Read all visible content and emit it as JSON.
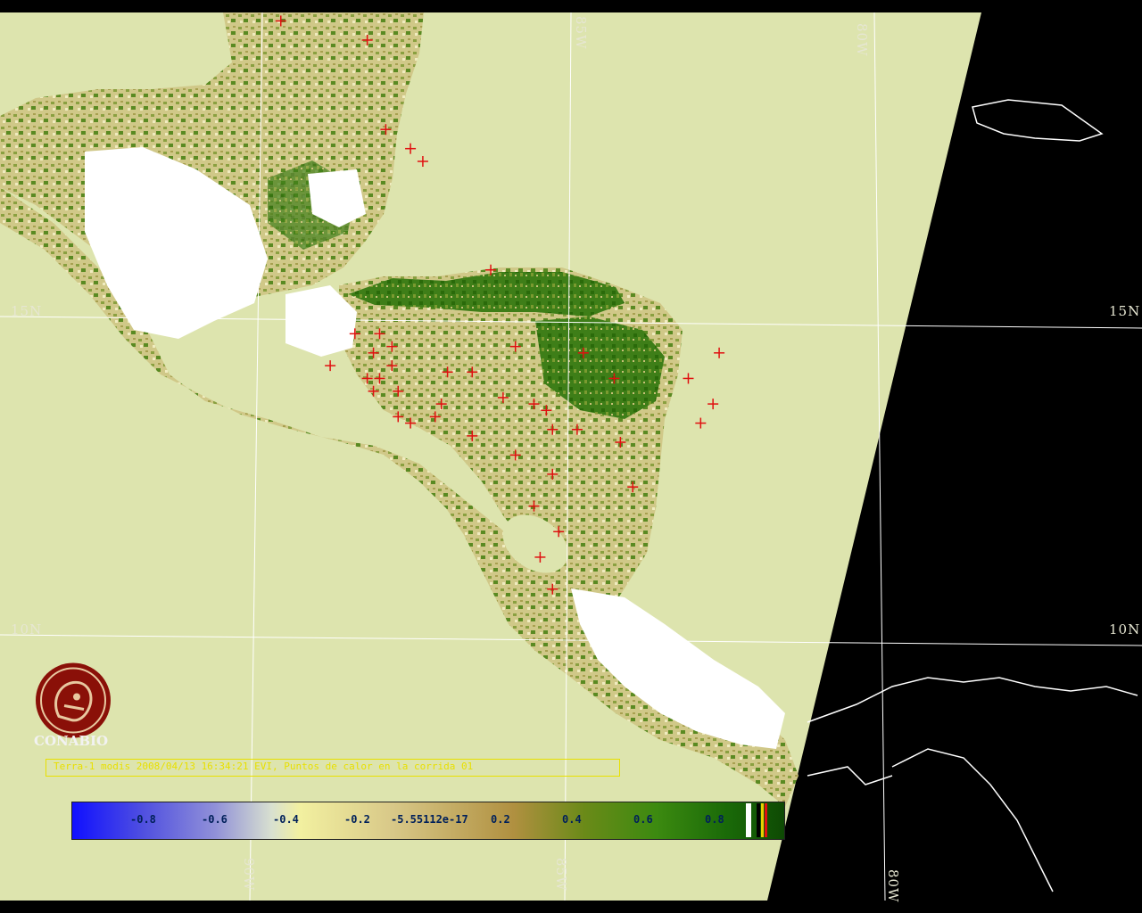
{
  "map": {
    "lat_labels": [
      "15N",
      "15N",
      "10N",
      "10N"
    ],
    "lon_labels": [
      "85W",
      "80W",
      "90W",
      "85W",
      "80W"
    ]
  },
  "logo": {
    "name": "CONABIO"
  },
  "caption": "Terra-1 modis 2008/04/13 16:34:21 EVI, Puntos de calor en la corrida 01",
  "colorbar": {
    "ticks": [
      "-0.8",
      "-0.6",
      "-0.4",
      "-0.2",
      "-5.55112e-17",
      "0.2",
      "0.4",
      "0.6",
      "0.8"
    ]
  },
  "colors": {
    "background": "#000000",
    "ocean_swath": "#dde4ae",
    "vegetation_dark": "#2f7a12",
    "vegetation_light": "#c8c070",
    "clouds": "#ffffff",
    "hotspot": "#e01010",
    "graticule": "#ffffff",
    "caption": "#e8e000"
  },
  "hotspots": [
    [
      -88.3,
      21.4
    ],
    [
      -88.1,
      21.2
    ],
    [
      -87.9,
      21.3
    ],
    [
      -87.7,
      21.0
    ],
    [
      -87.5,
      21.2
    ],
    [
      -88.0,
      20.9
    ],
    [
      -87.7,
      20.6
    ],
    [
      -88.2,
      20.4
    ],
    [
      -87.4,
      20.7
    ],
    [
      -89.7,
      19.7
    ],
    [
      -88.3,
      19.4
    ],
    [
      -88.0,
      18.0
    ],
    [
      -87.6,
      17.7
    ],
    [
      -87.4,
      17.5
    ],
    [
      -86.3,
      15.8
    ],
    [
      -88.5,
      14.8
    ],
    [
      -88.1,
      14.8
    ],
    [
      -87.9,
      14.6
    ],
    [
      -88.2,
      14.5
    ],
    [
      -87.9,
      14.3
    ],
    [
      -88.9,
      14.3
    ],
    [
      -88.3,
      14.1
    ],
    [
      -88.1,
      14.1
    ],
    [
      -88.2,
      13.9
    ],
    [
      -87.8,
      13.9
    ],
    [
      -87.8,
      13.5
    ],
    [
      -87.6,
      13.4
    ],
    [
      -87.2,
      13.5
    ],
    [
      -87.0,
      14.2
    ],
    [
      -86.6,
      14.2
    ],
    [
      -86.1,
      13.8
    ],
    [
      -85.9,
      14.6
    ],
    [
      -85.6,
      13.7
    ],
    [
      -85.4,
      13.6
    ],
    [
      -85.3,
      13.3
    ],
    [
      -84.9,
      13.3
    ],
    [
      -84.8,
      14.5
    ],
    [
      -84.3,
      14.1
    ],
    [
      -84.0,
      12.4
    ],
    [
      -84.2,
      13.1
    ],
    [
      -83.1,
      14.1
    ],
    [
      -82.6,
      14.5
    ],
    [
      -82.7,
      13.7
    ],
    [
      -82.9,
      13.4
    ],
    [
      -85.3,
      12.6
    ],
    [
      -85.9,
      12.9
    ],
    [
      -85.6,
      12.1
    ],
    [
      -85.2,
      11.7
    ],
    [
      -85.5,
      11.3
    ],
    [
      -85.3,
      10.8
    ],
    [
      -87.1,
      13.7
    ],
    [
      -86.6,
      13.2
    ]
  ]
}
